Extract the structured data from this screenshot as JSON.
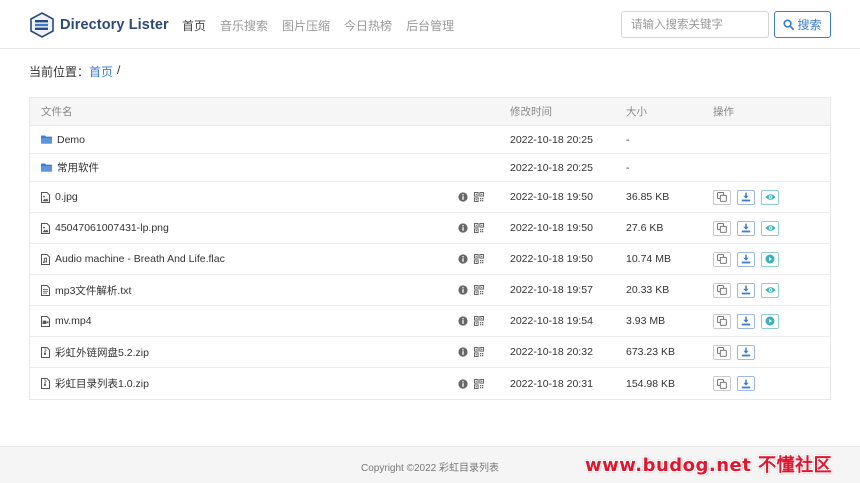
{
  "brand": {
    "name": "Directory Lister",
    "accent": "#3c7bd0"
  },
  "nav": [
    {
      "label": "首页",
      "active": true
    },
    {
      "label": "音乐搜索",
      "active": false
    },
    {
      "label": "图片压缩",
      "active": false
    },
    {
      "label": "今日热榜",
      "active": false
    },
    {
      "label": "后台管理",
      "active": false
    }
  ],
  "search": {
    "placeholder": "请输入搜索关键字",
    "value": "",
    "button_label": "搜索",
    "icon": "search-icon"
  },
  "breadcrumb": {
    "prefix": "当前位置：",
    "home": "首页",
    "separator": "/"
  },
  "table": {
    "headers": {
      "name": "文件名",
      "time": "修改时间",
      "size": "大小",
      "ops": "操作"
    },
    "rows": [
      {
        "name": "Demo",
        "type": "folder",
        "time": "2022-10-18 20:25",
        "size": "-"
      },
      {
        "name": "常用软件",
        "type": "folder",
        "time": "2022-10-18 20:25",
        "size": "-"
      },
      {
        "name": "0.jpg",
        "type": "image",
        "time": "2022-10-18 19:50",
        "size": "36.85 KB",
        "preview": "eye-icon"
      },
      {
        "name": "45047061007431-lp.png",
        "type": "image",
        "time": "2022-10-18 19:50",
        "size": "27.6 KB",
        "preview": "eye-icon"
      },
      {
        "name": "Audio machine - Breath And Life.flac",
        "type": "audio",
        "time": "2022-10-18 19:50",
        "size": "10.74 MB",
        "preview": "play-icon"
      },
      {
        "name": "mp3文件解析.txt",
        "type": "text",
        "time": "2022-10-18 19:57",
        "size": "20.33 KB",
        "preview": "eye-icon"
      },
      {
        "name": "mv.mp4",
        "type": "video",
        "time": "2022-10-18 19:54",
        "size": "3.93 MB",
        "preview": "play-icon"
      },
      {
        "name": "彩虹外链网盘5.2.zip",
        "type": "archive",
        "time": "2022-10-18 20:32",
        "size": "673.23 KB",
        "preview": ""
      },
      {
        "name": "彩虹目录列表1.0.zip",
        "type": "archive",
        "time": "2022-10-18 20:31",
        "size": "154.98 KB",
        "preview": ""
      }
    ]
  },
  "footer": {
    "copyright": "Copyright ©2022 彩虹目录列表"
  },
  "watermark": {
    "text": "www.budog.net 不懂社区"
  }
}
